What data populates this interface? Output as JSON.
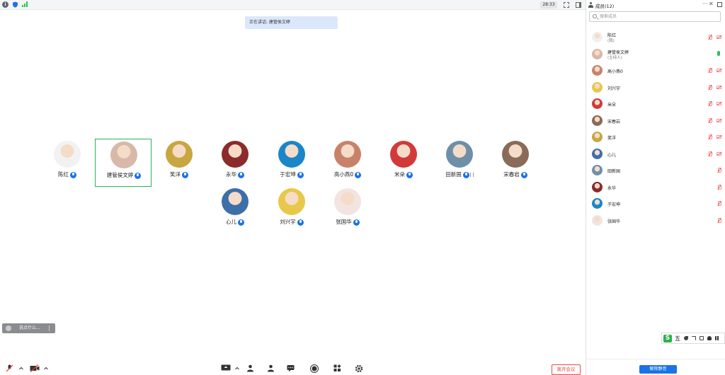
{
  "topbar": {
    "timer": "28:33"
  },
  "banner": {
    "speaking_text": "正在讲话: 建管侯文婷"
  },
  "tiles": [
    {
      "name": "陈红",
      "mic": true,
      "volume": false,
      "active": false,
      "avatar_color": "#f2f2f2"
    },
    {
      "name": "建管侯文婷",
      "mic": true,
      "volume": false,
      "active": true,
      "avatar_color": "#d8b8a8"
    },
    {
      "name": "笑洋",
      "mic": true,
      "volume": false,
      "active": false,
      "avatar_color": "#c8a640"
    },
    {
      "name": "永华",
      "mic": true,
      "volume": false,
      "active": false,
      "avatar_color": "#8b2b2b"
    },
    {
      "name": "于宏坤",
      "mic": true,
      "volume": false,
      "active": false,
      "avatar_color": "#1a86c8"
    },
    {
      "name": "高小燕0",
      "mic": true,
      "volume": false,
      "active": false,
      "avatar_color": "#c9826a"
    },
    {
      "name": "米朵",
      "mic": true,
      "volume": false,
      "active": false,
      "avatar_color": "#d23a3a"
    },
    {
      "name": "田新国",
      "mic": true,
      "volume": true,
      "active": false,
      "avatar_color": "#6f8fa8"
    },
    {
      "name": "宋春岩",
      "mic": true,
      "volume": false,
      "active": false,
      "avatar_color": "#8a6a58"
    },
    {
      "name": "心儿",
      "mic": true,
      "volume": false,
      "active": false,
      "avatar_color": "#3d6fa8"
    },
    {
      "name": "刘兴宇",
      "mic": true,
      "volume": false,
      "active": false,
      "avatar_color": "#e8c84a"
    },
    {
      "name": "张国华",
      "mic": true,
      "volume": false,
      "active": false,
      "avatar_color": "#f2e4e0"
    }
  ],
  "chat": {
    "hint": "说点什么..."
  },
  "toolbar": {
    "leave_label": "离开会议"
  },
  "panel": {
    "title": "成员(12)",
    "search_placeholder": "搜索成员",
    "members": [
      {
        "name": "陈红",
        "sub": "(我)",
        "muted": true,
        "cam_off": true,
        "avatar_color": "#f0f0f0"
      },
      {
        "name": "建管侯文婷",
        "sub": "(主持人)",
        "muted": false,
        "cam_off": false,
        "speaking": true,
        "avatar_color": "#d8b8a8"
      },
      {
        "name": "高小燕0",
        "sub": "",
        "muted": true,
        "cam_off": true,
        "avatar_color": "#c9826a"
      },
      {
        "name": "刘兴宇",
        "sub": "",
        "muted": true,
        "cam_off": true,
        "avatar_color": "#e8c84a"
      },
      {
        "name": "米朵",
        "sub": "",
        "muted": true,
        "cam_off": true,
        "avatar_color": "#d23a3a"
      },
      {
        "name": "宋春岩",
        "sub": "",
        "muted": true,
        "cam_off": true,
        "avatar_color": "#8a6a58"
      },
      {
        "name": "笑洋",
        "sub": "",
        "muted": true,
        "cam_off": true,
        "avatar_color": "#c8a640"
      },
      {
        "name": "心儿",
        "sub": "",
        "muted": true,
        "cam_off": true,
        "avatar_color": "#3d6fa8"
      },
      {
        "name": "田新国",
        "sub": "",
        "muted": true,
        "cam_off": false,
        "avatar_color": "#6f8fa8"
      },
      {
        "name": "永华",
        "sub": "",
        "muted": true,
        "cam_off": false,
        "avatar_color": "#8b2b2b"
      },
      {
        "name": "于宏坤",
        "sub": "",
        "muted": true,
        "cam_off": false,
        "avatar_color": "#1a86c8"
      },
      {
        "name": "张国华",
        "sub": "",
        "muted": true,
        "cam_off": false,
        "avatar_color": "#f2e4e0"
      }
    ],
    "unmute_all_label": "解除静音"
  },
  "ime": {
    "mode": "五"
  }
}
